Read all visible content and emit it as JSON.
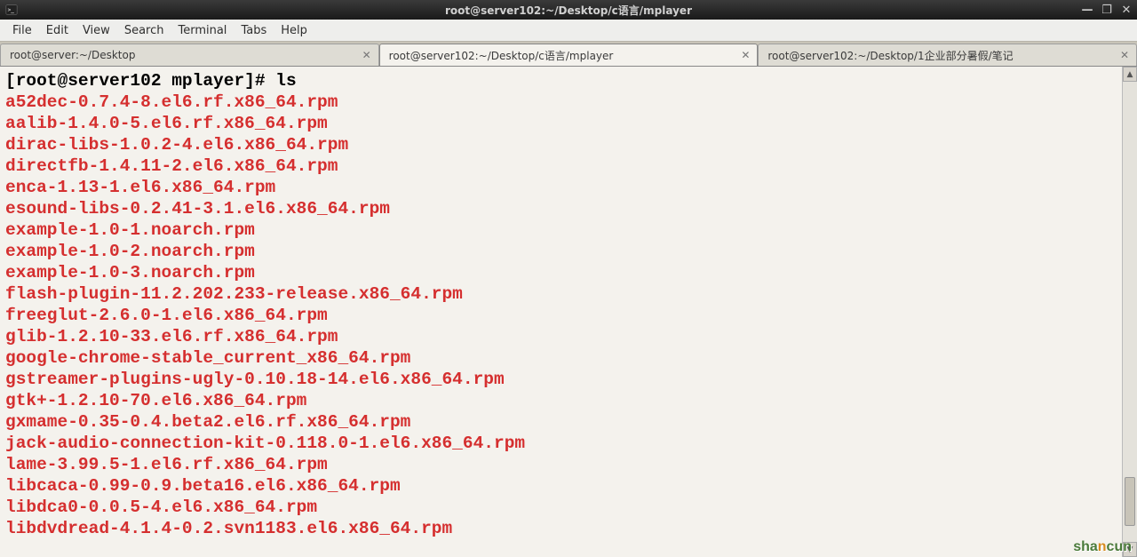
{
  "titlebar": {
    "title": "root@server102:~/Desktop/c语言/mplayer",
    "minimize": "—",
    "maximize": "❐",
    "close": "✕"
  },
  "menubar": {
    "items": [
      "File",
      "Edit",
      "View",
      "Search",
      "Terminal",
      "Tabs",
      "Help"
    ]
  },
  "tabs": [
    {
      "label": "root@server:~/Desktop",
      "active": false
    },
    {
      "label": "root@server102:~/Desktop/c语言/mplayer",
      "active": true
    },
    {
      "label": "root@server102:~/Desktop/1企业部分暑假/笔记",
      "active": false
    }
  ],
  "terminal": {
    "prompt": "[root@server102 mplayer]# ",
    "command": "ls",
    "files": [
      "a52dec-0.7.4-8.el6.rf.x86_64.rpm",
      "aalib-1.4.0-5.el6.rf.x86_64.rpm",
      "dirac-libs-1.0.2-4.el6.x86_64.rpm",
      "directfb-1.4.11-2.el6.x86_64.rpm",
      "enca-1.13-1.el6.x86_64.rpm",
      "esound-libs-0.2.41-3.1.el6.x86_64.rpm",
      "example-1.0-1.noarch.rpm",
      "example-1.0-2.noarch.rpm",
      "example-1.0-3.noarch.rpm",
      "flash-plugin-11.2.202.233-release.x86_64.rpm",
      "freeglut-2.6.0-1.el6.x86_64.rpm",
      "glib-1.2.10-33.el6.rf.x86_64.rpm",
      "google-chrome-stable_current_x86_64.rpm",
      "gstreamer-plugins-ugly-0.10.18-14.el6.x86_64.rpm",
      "gtk+-1.2.10-70.el6.x86_64.rpm",
      "gxmame-0.35-0.4.beta2.el6.rf.x86_64.rpm",
      "jack-audio-connection-kit-0.118.0-1.el6.x86_64.rpm",
      "lame-3.99.5-1.el6.rf.x86_64.rpm",
      "libcaca-0.99-0.9.beta16.el6.x86_64.rpm",
      "libdca0-0.0.5-4.el6.x86_64.rpm",
      "libdvdread-4.1.4-0.2.svn1183.el6.x86_64.rpm"
    ]
  },
  "watermark": {
    "p1": "sha",
    "p2": "n",
    "p3": "cun"
  },
  "colors": {
    "terminal_bg": "#f4f2ed",
    "file_red": "#d52f2f",
    "prompt": "#000000"
  }
}
